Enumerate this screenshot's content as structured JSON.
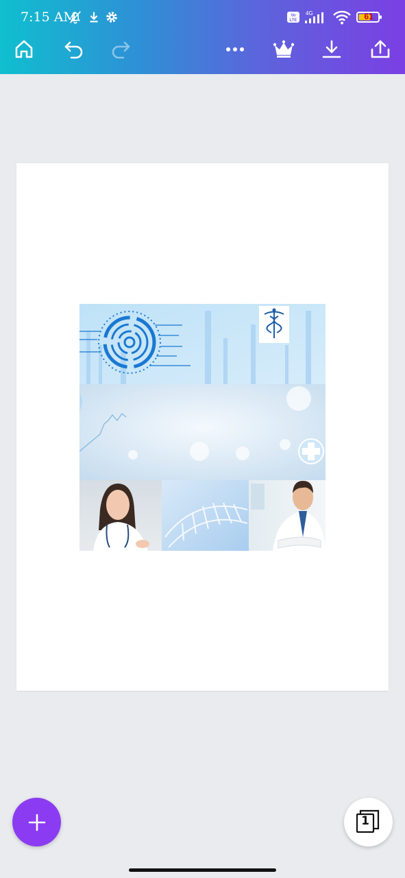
{
  "status_bar": {
    "time": "7:15 AM",
    "battery_level": "61",
    "network": "4G",
    "volte": "Vo LTE"
  },
  "toolbar": {
    "home_icon": "home-icon",
    "undo_icon": "undo-icon",
    "redo_icon": "redo-icon",
    "more_icon": "more-icon",
    "premium_icon": "crown-icon",
    "download_icon": "download-icon",
    "share_icon": "share-icon"
  },
  "colors": {
    "gradient_start": "#0fbfcf",
    "gradient_end": "#7b3fe4",
    "fab": "#8b3cf2",
    "canvas_bg": "#e9ebef"
  },
  "pages": {
    "count": "1"
  }
}
